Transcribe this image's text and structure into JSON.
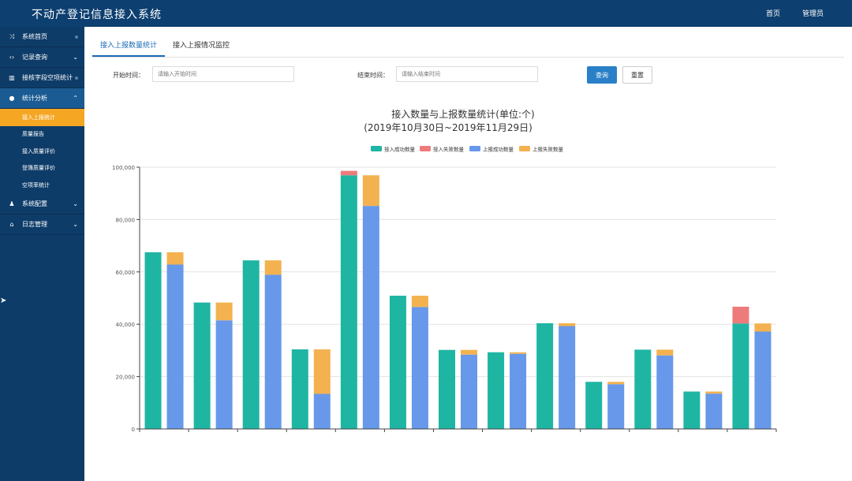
{
  "header": {
    "app_title": "不动产登记信息接入系统",
    "links": [
      "首页",
      "管理员"
    ]
  },
  "sidebar": {
    "items": [
      {
        "label": "系统首页",
        "icon": "shuffle-icon",
        "glyph": "⤨",
        "right": "dot"
      },
      {
        "label": "记录查询",
        "icon": "code-icon",
        "glyph": "‹›",
        "right": "chevron"
      },
      {
        "label": "接核字段空项统计",
        "icon": "bar-chart-icon",
        "glyph": "▥",
        "right": "dot"
      },
      {
        "label": "统计分析",
        "icon": "user-icon",
        "glyph": "●",
        "right": "chevron-up",
        "active": true
      }
    ],
    "sub_items": [
      "接入上报统计",
      "质量报告",
      "接入质量评价",
      "登簿质量评价",
      "空项率统计"
    ],
    "active_sub": 0,
    "bottom_items": [
      {
        "label": "系统配置",
        "icon": "users-icon",
        "glyph": "♟",
        "right": "chevron"
      },
      {
        "label": "日志管理",
        "icon": "bank-icon",
        "glyph": "⌂",
        "right": "chevron"
      }
    ]
  },
  "tabs": [
    "接入上报数量统计",
    "接入上报情况监控"
  ],
  "filters": {
    "start_label": "开始时间：",
    "start_placeholder": "请输入开始时间",
    "end_label": "结束时间：",
    "end_placeholder": "请输入结束时间",
    "query_button": "查询",
    "reset_button": "重置"
  },
  "colors": {
    "access_success": "#1fb5a3",
    "access_fail": "#ee7b7b",
    "report_success": "#6798ea",
    "report_fail": "#f3b24f"
  },
  "chart_data": {
    "type": "bar",
    "title": "接入数量与上报数量统计(单位:个)",
    "subtitle": "(2019年10月30日~2019年11月29日)",
    "legend_position": "top-center",
    "grid": true,
    "ylim": [
      0,
      100000
    ],
    "yticks": [
      "0",
      "20,000",
      "40,000",
      "60,000",
      "80,000",
      "100,000"
    ],
    "categories": [
      "",
      "",
      "",
      "",
      "",
      "",
      "",
      "",
      "",
      "",
      "",
      "",
      "",
      "",
      ""
    ],
    "stacks": [
      {
        "stack": "access",
        "series": [
          {
            "name": "接入成功数量",
            "values": [
              67500,
              48300,
              64400,
              30400,
              96900,
              50900,
              30200,
              29300,
              40400,
              18000,
              30300,
              14300,
              40300
            ]
          },
          {
            "name": "接入失败数量",
            "values": [
              0,
              0,
              0,
              0,
              1700,
              0,
              0,
              0,
              0,
              0,
              0,
              0,
              6400
            ]
          }
        ]
      },
      {
        "stack": "report",
        "series": [
          {
            "name": "上报成功数量",
            "values": [
              62800,
              41500,
              58900,
              13400,
              85200,
              46600,
              28400,
              28700,
              39300,
              17100,
              28100,
              13500,
              37200
            ]
          },
          {
            "name": "上报失败数量",
            "values": [
              4700,
              6800,
              5500,
              17000,
              11700,
              4300,
              1800,
              600,
              1100,
              900,
              2200,
              800,
              3100
            ]
          }
        ]
      }
    ]
  }
}
